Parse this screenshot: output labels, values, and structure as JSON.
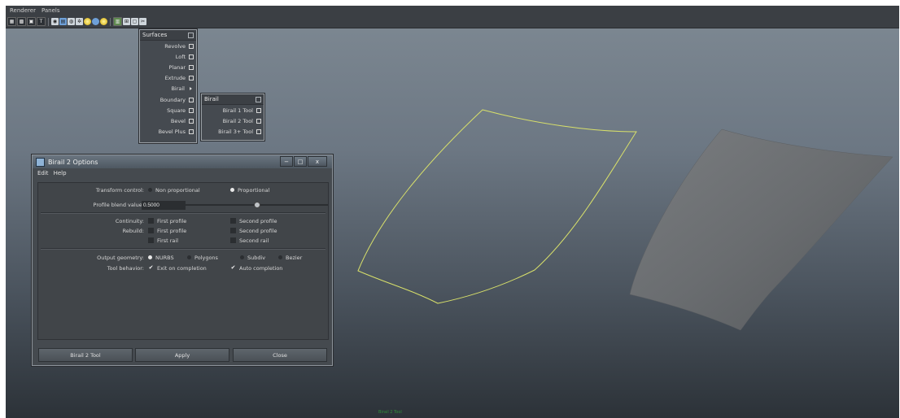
{
  "menubar": {
    "items": [
      "Renderer",
      "Panels"
    ]
  },
  "toolbar": {
    "icons": [
      "wireframe-icon",
      "smooth-shade-icon",
      "textured-icon",
      "lights-icon",
      "camera-icon",
      "render-view-icon",
      "ipr-icon",
      "render-settings-icon",
      "sun-light-icon",
      "point-light-icon",
      "spot-light-icon",
      "isolate-icon",
      "grid-icon",
      "frame-icon",
      "xray-icon"
    ]
  },
  "surfaces_menu": {
    "title": "Surfaces",
    "items": [
      {
        "label": "Revolve",
        "option": true
      },
      {
        "label": "Loft",
        "option": true
      },
      {
        "label": "Planar",
        "option": true
      },
      {
        "label": "Extrude",
        "option": true
      },
      {
        "label": "Birail",
        "submenu": true
      },
      {
        "label": "Boundary",
        "option": true
      },
      {
        "label": "Square",
        "option": true
      },
      {
        "label": "Bevel",
        "option": true
      },
      {
        "label": "Bevel Plus",
        "option": true
      }
    ]
  },
  "birail_menu": {
    "title": "Birail",
    "items": [
      {
        "label": "Birail 1 Tool"
      },
      {
        "label": "Birail 2 Tool"
      },
      {
        "label": "Birail 3+ Tool"
      }
    ]
  },
  "dialog": {
    "title": "Birail 2 Options",
    "window_buttons": {
      "minimize": "−",
      "maximize": "□",
      "close": "x"
    },
    "menu": [
      "Edit",
      "Help"
    ],
    "transform_control": {
      "label": "Transform control:",
      "options": [
        "Non proportional",
        "Proportional"
      ],
      "selected": "Proportional"
    },
    "profile_blend": {
      "label": "Profile blend value:",
      "value": "0.5000",
      "slider_fraction": 0.5
    },
    "continuity": {
      "label": "Continuity:",
      "first": "First profile",
      "second": "Second profile"
    },
    "rebuild": {
      "label": "Rebuild:",
      "first": "First profile",
      "second": "Second profile",
      "first_rail": "First rail",
      "second_rail": "Second rail"
    },
    "output_geometry": {
      "label": "Output geometry:",
      "options": [
        "NURBS",
        "Polygons",
        "Subdiv",
        "Bezier"
      ],
      "selected": "NURBS"
    },
    "tool_behavior": {
      "label": "Tool behavior:",
      "exit": "Exit on completion",
      "exit_checked": true,
      "auto": "Auto completion",
      "auto_checked": true
    },
    "buttons": {
      "tool": "Birail 2 Tool",
      "apply": "Apply",
      "close": "Close"
    }
  },
  "status_bar": {
    "text": "Birail 2 Tool"
  },
  "colors": {
    "curve": "#d8e06a",
    "surface": "#6e7275",
    "dialog_bg": "#454a4f"
  }
}
